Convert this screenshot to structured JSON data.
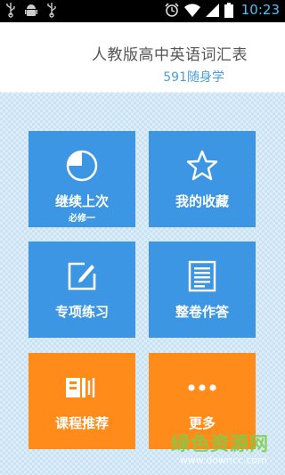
{
  "status_bar": {
    "time": "10:23",
    "icons": [
      "usb-icon",
      "android-debug-icon",
      "usb-icon",
      "alarm-icon",
      "wifi-icon",
      "signal-icon",
      "battery-icon"
    ]
  },
  "header": {
    "title": "人教版高中英语词汇表",
    "subtitle": "591随身学"
  },
  "tiles": [
    {
      "label": "继续上次",
      "sublabel": "必修一",
      "icon": "progress-pie-icon",
      "color": "#3d96e3"
    },
    {
      "label": "我的收藏",
      "icon": "star-icon",
      "color": "#3d96e3"
    },
    {
      "label": "专项练习",
      "icon": "edit-icon",
      "color": "#3d96e3"
    },
    {
      "label": "整卷作答",
      "icon": "document-icon",
      "color": "#3d96e3"
    },
    {
      "label": "课程推荐",
      "icon": "audio-book-icon",
      "color": "#ff8c1a"
    },
    {
      "label": "更多",
      "icon": "more-dots-icon",
      "color": "#ff8c1a"
    }
  ],
  "watermark": {
    "line1": "绿色资源网",
    "line2": "www.downcc.com"
  }
}
